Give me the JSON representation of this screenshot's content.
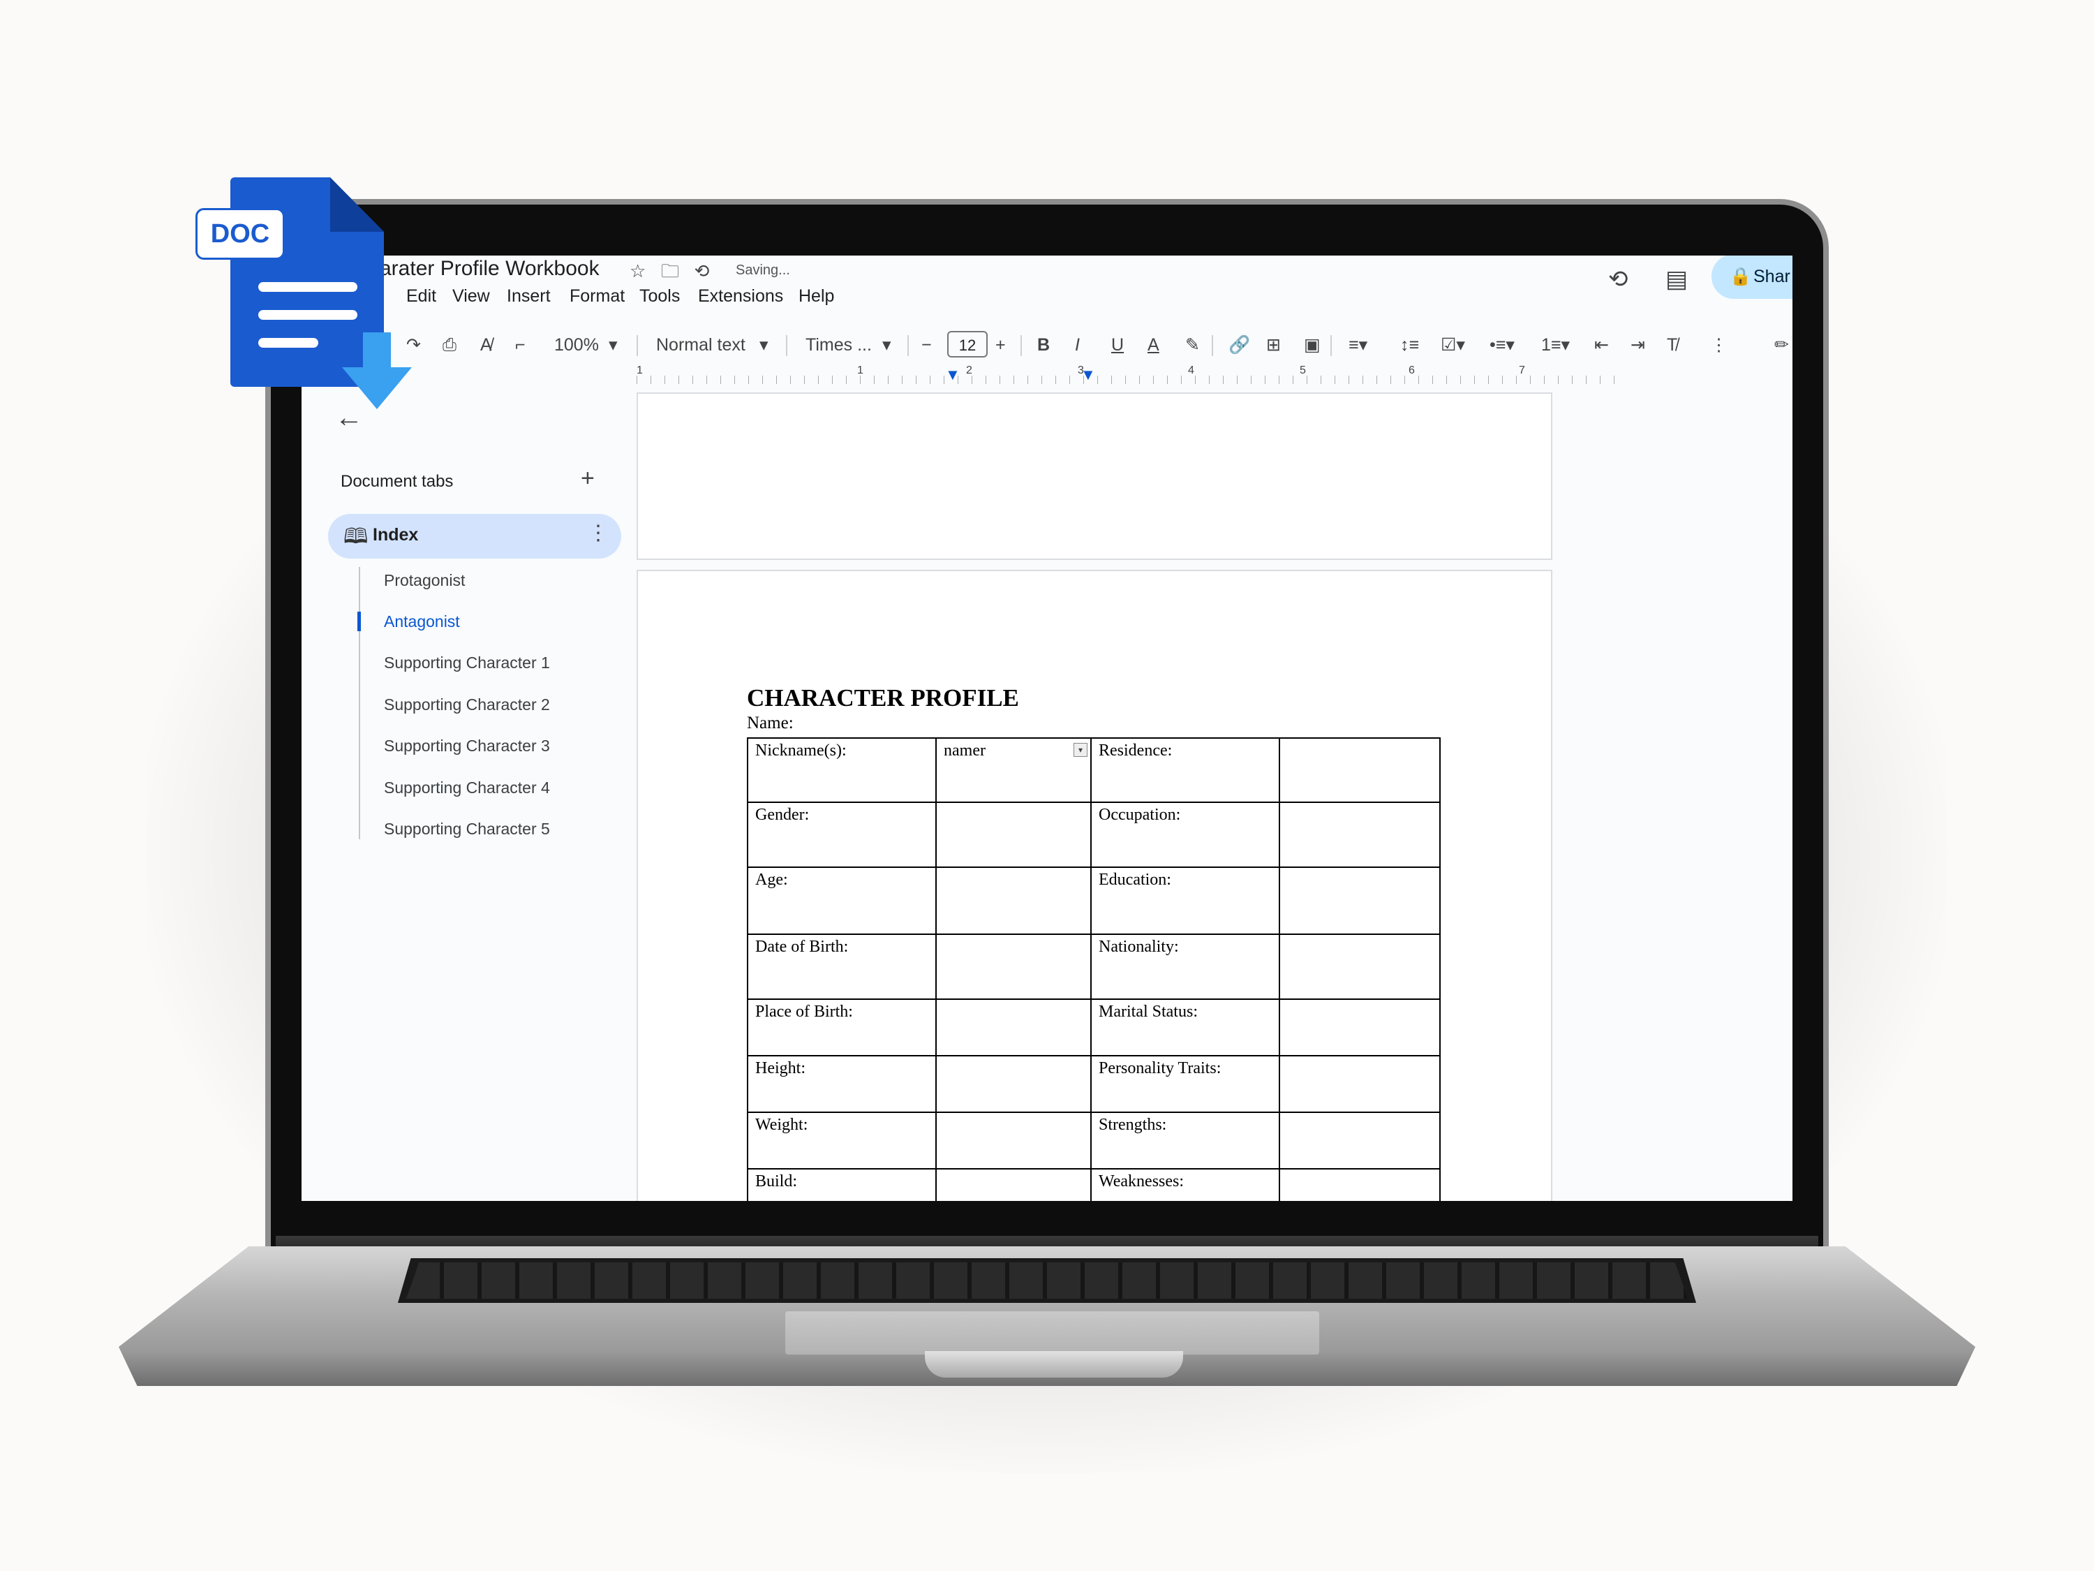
{
  "doc": {
    "title": "arater Profile Workbook",
    "status": "Saving...",
    "menu": [
      "e",
      "Edit",
      "View",
      "Insert",
      "Format",
      "Tools",
      "Extensions",
      "Help"
    ],
    "share_label": "Shar"
  },
  "toolbar": {
    "zoom": "100%",
    "style": "Normal text",
    "font": "Times ...",
    "font_size": "12"
  },
  "ruler": [
    "1",
    "1",
    "2",
    "3",
    "4",
    "5",
    "6",
    "7"
  ],
  "sidebar": {
    "header": "Document tabs",
    "index_label": "Index",
    "items": [
      "Protagonist",
      "Antagonist",
      "Supporting Character 1",
      "Supporting Character 2",
      "Supporting Character 3",
      "Supporting Character 4",
      "Supporting Character 5"
    ],
    "active_item": "Antagonist"
  },
  "profile": {
    "heading": "CHARACTER PROFILE",
    "name_label": "Name:",
    "rows": [
      {
        "left": "Nickname(s):",
        "left_value": "namer",
        "right": "Residence:"
      },
      {
        "left": "Gender:",
        "left_value": "",
        "right": "Occupation:"
      },
      {
        "left": "Age:",
        "left_value": "",
        "right": "Education:"
      },
      {
        "left": "Date of Birth:",
        "left_value": "",
        "right": "Nationality:"
      },
      {
        "left": "Place of Birth:",
        "left_value": "",
        "right": "Marital Status:"
      },
      {
        "left": "Height:",
        "left_value": "",
        "right": "Personality Traits:"
      },
      {
        "left": "Weight:",
        "left_value": "",
        "right": "Strengths:"
      },
      {
        "left": "Build:",
        "left_value": "",
        "right": "Weaknesses:"
      }
    ]
  },
  "badge": {
    "label": "DOC"
  },
  "colors": {
    "accent": "#0b57d0",
    "tab_active_bg": "#d3e3fd",
    "share_bg": "#c2e7ff",
    "doc_icon": "#1a5bcf",
    "arrow": "#3aa0f0"
  }
}
